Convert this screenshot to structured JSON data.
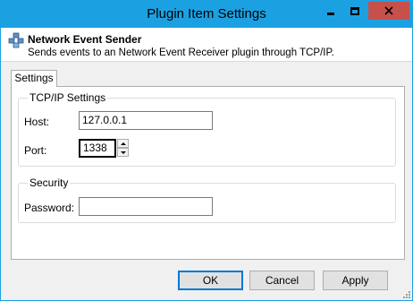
{
  "window": {
    "title": "Plugin Item Settings",
    "accent_color": "#1ba1e2",
    "close_color": "#c7504b",
    "minimize_icon": "minimize-icon",
    "maximize_icon": "maximize-icon",
    "close_icon": "close-icon"
  },
  "header": {
    "icon": "plugin-icon",
    "title": "Network Event Sender",
    "description": "Sends events to an Network Event Receiver plugin through TCP/IP."
  },
  "tabs": [
    {
      "label": "Settings",
      "selected": true
    }
  ],
  "tcpip_group": {
    "legend": "TCP/IP Settings",
    "host_label": "Host:",
    "host_value": "127.0.0.1",
    "port_label": "Port:",
    "port_value": "1338"
  },
  "security_group": {
    "legend": "Security",
    "password_label": "Password:",
    "password_value": ""
  },
  "buttons": {
    "ok": "OK",
    "cancel": "Cancel",
    "apply": "Apply"
  }
}
